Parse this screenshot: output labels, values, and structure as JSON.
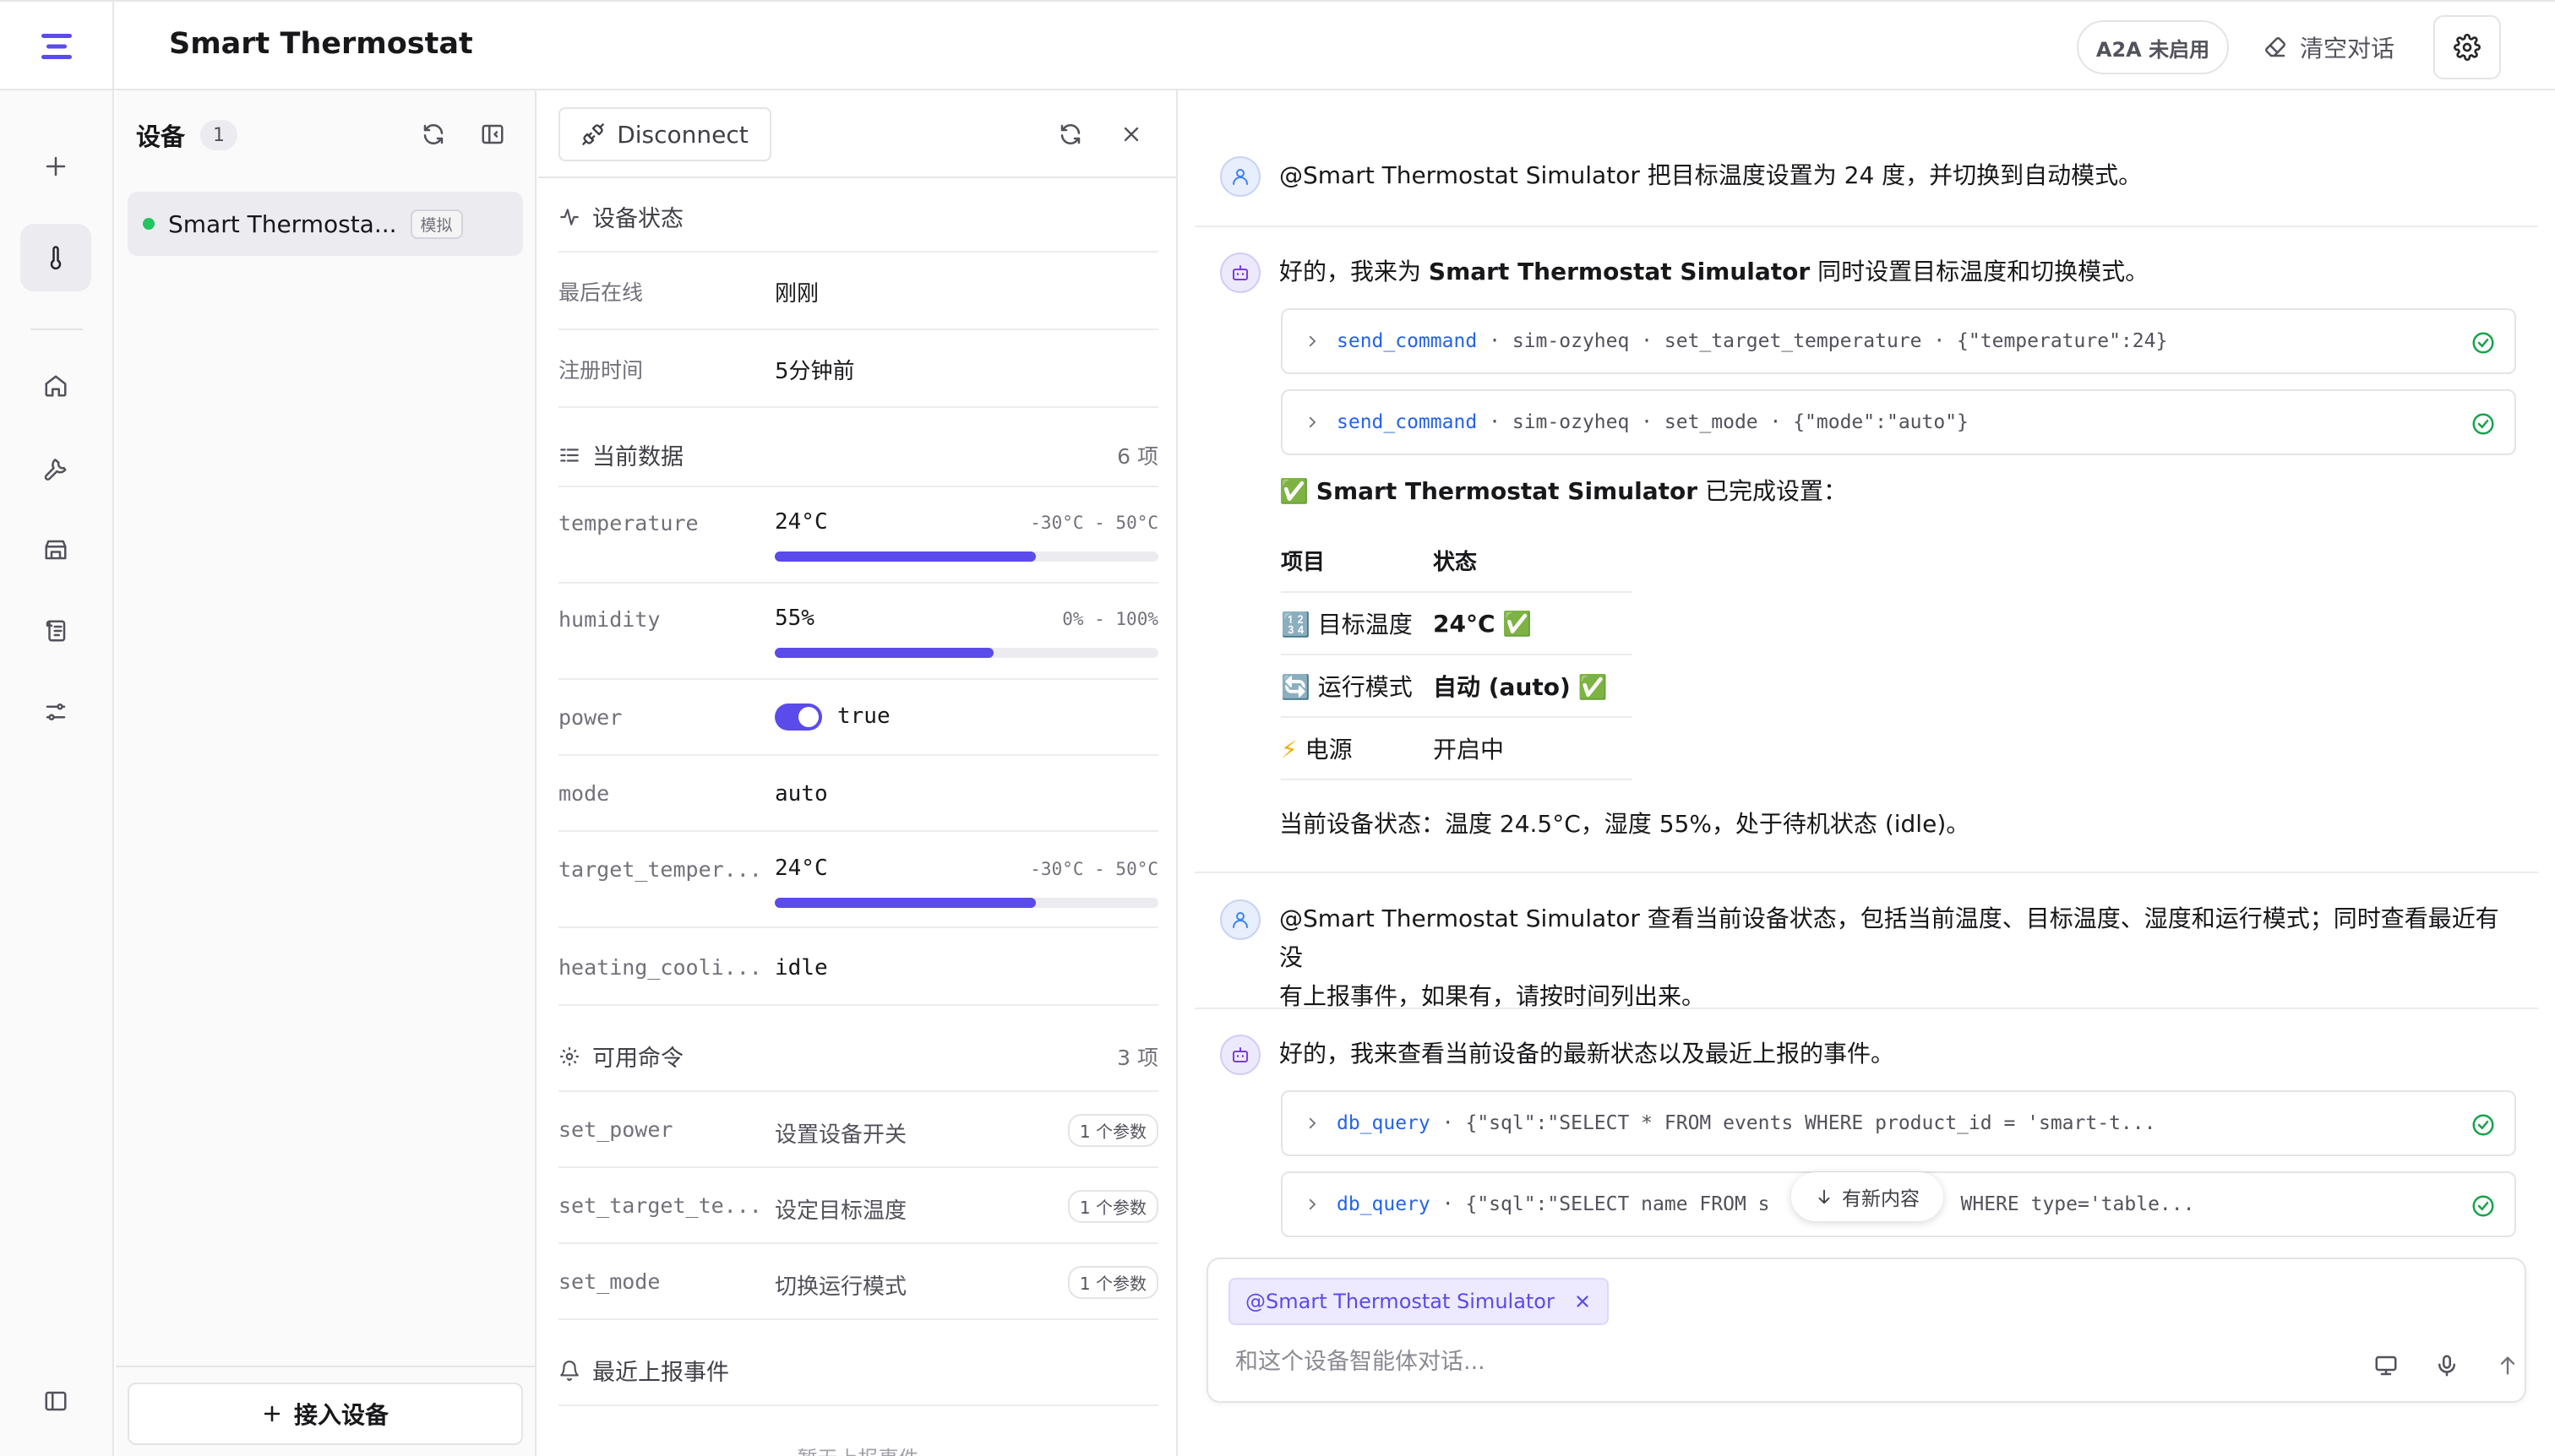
{
  "app": {
    "title": "Smart Thermostat",
    "a2a_label": "A2A 未启用",
    "clear_label": "清空对话"
  },
  "devices": {
    "title": "设备",
    "count": "1",
    "items": [
      {
        "name": "Smart Thermosta...",
        "badge": "模拟"
      }
    ],
    "add_label": "接入设备"
  },
  "detail": {
    "disconnect_label": "Disconnect",
    "status": {
      "title": "设备状态",
      "rows": [
        {
          "key": "最后在线",
          "value": "刚刚"
        },
        {
          "key": "注册时间",
          "value": "5分钟前"
        }
      ]
    },
    "current": {
      "title": "当前数据",
      "count": "6 项",
      "rows": [
        {
          "key": "temperature",
          "value": "24°C",
          "range": "-30°C - 50°C",
          "fraction": 0.68
        },
        {
          "key": "humidity",
          "value": "55%",
          "range": "0% - 100%",
          "fraction": 0.57
        },
        {
          "key": "power",
          "value": "true"
        },
        {
          "key": "mode",
          "value": "auto"
        },
        {
          "key": "target_temper...",
          "value": "24°C",
          "range": "-30°C - 50°C",
          "fraction": 0.68
        },
        {
          "key": "heating_cooli...",
          "value": "idle"
        }
      ]
    },
    "commands": {
      "title": "可用命令",
      "count": "3 项",
      "rows": [
        {
          "key": "set_power",
          "value": "设置设备开关",
          "badge": "1 个参数"
        },
        {
          "key": "set_target_te...",
          "value": "设定目标温度",
          "badge": "1 个参数"
        },
        {
          "key": "set_mode",
          "value": "切换运行模式",
          "badge": "1 个参数"
        }
      ]
    },
    "events": {
      "title": "最近上报事件",
      "partial": "暂无上报事件"
    }
  },
  "chat": {
    "messages": [
      {
        "role": "user",
        "text": "@Smart Thermostat Simulator 把目标温度设置为 24 度，并切换到自动模式。"
      },
      {
        "role": "bot",
        "text_pre": "好的，我来为 ",
        "text_bold": "Smart Thermostat Simulator",
        "text_post": " 同时设置目标温度和切换模式。",
        "tools": [
          {
            "fn": "send_command",
            "args": "· sim-ozyheq · set_target_temperature · {\"temperature\":24}"
          },
          {
            "fn": "send_command",
            "args": "· sim-ozyheq · set_mode · {\"mode\":\"auto\"}"
          }
        ],
        "done_emoji": "✅",
        "done_bold": "Smart Thermostat Simulator",
        "done_text": " 已完成设置：",
        "table": {
          "headers": [
            "项目",
            "状态"
          ],
          "rows": [
            {
              "icon": "🔢",
              "item": "目标温度",
              "status": "24°C",
              "check": "✅"
            },
            {
              "icon": "🔄",
              "item": "运行模式",
              "status": "自动 (auto)",
              "check": "✅"
            },
            {
              "icon": "⚡",
              "item": "电源",
              "status": "开启中",
              "check": ""
            }
          ]
        },
        "summary": "当前设备状态：温度 24.5°C，湿度 55%，处于待机状态 (idle)。"
      },
      {
        "role": "user",
        "text_line1": "@Smart Thermostat Simulator 查看当前设备状态，包括当前温度、目标温度、湿度和运行模式；同时查看最近有没",
        "text_line2": "有上报事件，如果有，请按时间列出来。"
      },
      {
        "role": "bot",
        "text": "好的，我来查看当前设备的最新状态以及最近上报的事件。",
        "tools": [
          {
            "fn": "db_query",
            "args": "· {\"sql\":\"SELECT * FROM events WHERE product_id = 'smart-t..."
          },
          {
            "fn": "db_query",
            "args_left": "· {\"sql\":\"SELECT name FROM s",
            "args_right": "WHERE type='table..."
          }
        ]
      }
    ],
    "new_content_label": "有新内容",
    "composer": {
      "mention": "@Smart Thermostat Simulator",
      "placeholder": "和这个设备智能体对话..."
    }
  },
  "colors": {
    "accent": "#5b4bea",
    "online": "#22c55e",
    "tool_fn": "#2563eb",
    "check": "#16a34a"
  }
}
